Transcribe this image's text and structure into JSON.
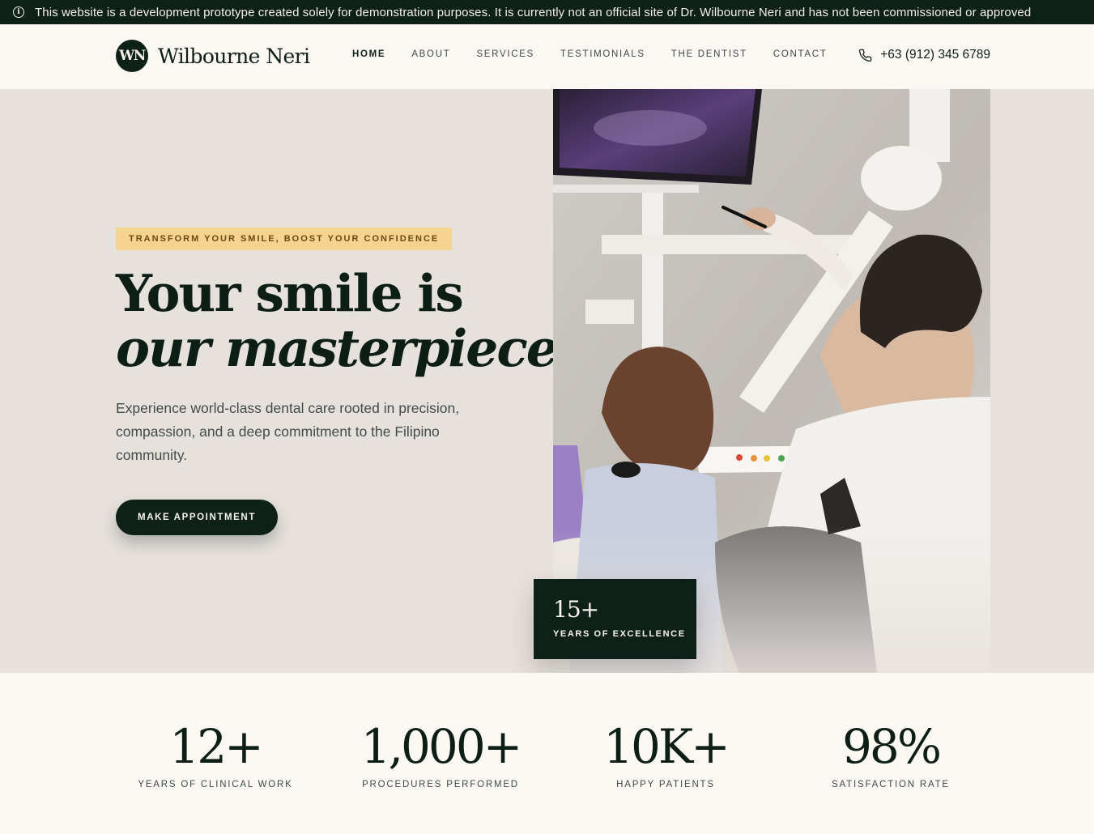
{
  "banner": {
    "icon": "info-icon",
    "text": "This website is a development prototype created solely for demonstration purposes. It is currently not an official site of Dr. Wilbourne Neri and has not been commissioned or approved"
  },
  "header": {
    "logo_mark": "WN",
    "logo_name": "Wilbourne Neri",
    "nav": [
      "HOME",
      "ABOUT",
      "SERVICES",
      "TESTIMONIALS",
      "THE DENTIST",
      "CONTACT"
    ],
    "active_nav": "HOME",
    "phone_icon": "phone-icon",
    "phone": "+63 (912) 345 6789"
  },
  "hero": {
    "tagline": "TRANSFORM YOUR SMILE, BOOST YOUR CONFIDENCE",
    "headline_line1": "Your smile is",
    "headline_line2": "our masterpiece",
    "lede": "Experience world-class dental care rooted in precision, compassion, and a deep commitment to the Filipino community.",
    "cta": "MAKE APPOINTMENT",
    "badge_value": "15+",
    "badge_label": "YEARS OF EXCELLENCE"
  },
  "stats": [
    {
      "value": "12+",
      "label": "YEARS OF CLINICAL WORK"
    },
    {
      "value": "1,000+",
      "label": "PROCEDURES PERFORMED"
    },
    {
      "value": "10K+",
      "label": "HAPPY PATIENTS"
    },
    {
      "value": "98%",
      "label": "SATISFACTION RATE"
    }
  ],
  "colors": {
    "brand_dark": "#0d2118",
    "hero_bg": "#e7e1dd",
    "page_bg": "#fbf8f4",
    "tag_bg": "#f4d48f"
  }
}
